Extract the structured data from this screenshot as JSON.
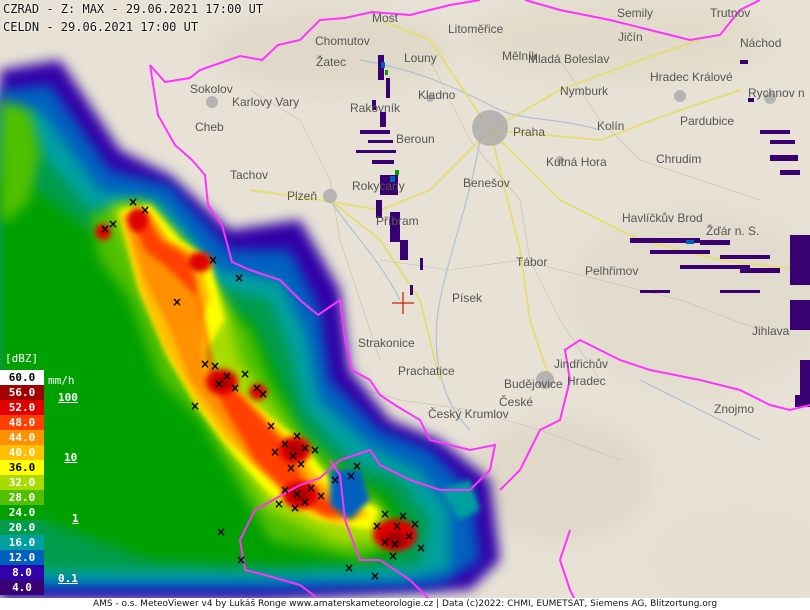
{
  "header": {
    "line1": "CZRAD - Z: MAX - 29.06.2021 17:00 UT",
    "line2": "CELDN - 29.06.2021 17:00 UT"
  },
  "legend": {
    "unit_dbz": "[dBZ]",
    "unit_rate": "mm/h",
    "levels": [
      {
        "label": "60.0",
        "color": "#ffffff",
        "text_color": "#000000"
      },
      {
        "label": "56.0",
        "color": "#a00000",
        "text_color": "#ffffff"
      },
      {
        "label": "52.0",
        "color": "#e00000",
        "text_color": "#ffffff"
      },
      {
        "label": "48.0",
        "color": "#ff4000",
        "text_color": "#ffffff"
      },
      {
        "label": "44.0",
        "color": "#ff9000",
        "text_color": "#ffffff"
      },
      {
        "label": "40.0",
        "color": "#ffc000",
        "text_color": "#ffffff"
      },
      {
        "label": "36.0",
        "color": "#ffff00",
        "text_color": "#000000"
      },
      {
        "label": "32.0",
        "color": "#a8dc00",
        "text_color": "#ffffff"
      },
      {
        "label": "28.0",
        "color": "#50c000",
        "text_color": "#ffffff"
      },
      {
        "label": "24.0",
        "color": "#00a000",
        "text_color": "#ffffff"
      },
      {
        "label": "20.0",
        "color": "#009c4c",
        "text_color": "#ffffff"
      },
      {
        "label": "16.0",
        "color": "#00a0a0",
        "text_color": "#ffffff"
      },
      {
        "label": "12.0",
        "color": "#0060c0",
        "text_color": "#ffffff"
      },
      {
        "label": "8.0",
        "color": "#3000a8",
        "text_color": "#ffffff"
      },
      {
        "label": "4.0",
        "color": "#380070",
        "text_color": "#ffffff"
      }
    ],
    "rates": [
      "100",
      "10",
      "1",
      "0.1"
    ]
  },
  "cities": [
    {
      "name": "Most"
    },
    {
      "name": "Litoměřice"
    },
    {
      "name": "Semily"
    },
    {
      "name": "Trutnov"
    },
    {
      "name": "Jičín"
    },
    {
      "name": "Náchod"
    },
    {
      "name": "Chomutov"
    },
    {
      "name": "Mělník"
    },
    {
      "name": "Mladá Boleslav"
    },
    {
      "name": "Žatec"
    },
    {
      "name": "Louny"
    },
    {
      "name": "Hradec Králové"
    },
    {
      "name": "Sokolov"
    },
    {
      "name": "Karlovy Vary"
    },
    {
      "name": "Kladno"
    },
    {
      "name": "Nymburk"
    },
    {
      "name": "Rychnov n"
    },
    {
      "name": "Rakovník"
    },
    {
      "name": "Praha"
    },
    {
      "name": "Cheb"
    },
    {
      "name": "Beroun"
    },
    {
      "name": "Kolín"
    },
    {
      "name": "Pardubice"
    },
    {
      "name": "Chrudim"
    },
    {
      "name": "Tachov"
    },
    {
      "name": "Kutná Hora"
    },
    {
      "name": "Plzeň"
    },
    {
      "name": "Rokycany"
    },
    {
      "name": "Benešov"
    },
    {
      "name": "Příbram"
    },
    {
      "name": "Havlíčkův Brod"
    },
    {
      "name": "Žďár n. S."
    },
    {
      "name": "Tábor"
    },
    {
      "name": "Písek"
    },
    {
      "name": "Pelhřimov"
    },
    {
      "name": "Strakonice"
    },
    {
      "name": "Jindřichův"
    },
    {
      "name": "Hradec"
    },
    {
      "name": "Prachatice"
    },
    {
      "name": "České"
    },
    {
      "name": "Budějovice"
    },
    {
      "name": "Znojmo"
    },
    {
      "name": "Český Krumlov"
    },
    {
      "name": "Jihlava"
    }
  ],
  "colors": {
    "border": "#ff33ff",
    "road": "#e8e070",
    "marker": "#cc2200"
  },
  "footer": "AMS - o.s. MeteoViewer v4 by Lukáš Ronge www.amaterskameteorologie.cz | Data (c)2022: CHMI, EUMETSAT, Siemens AG, Blitzortung.org"
}
